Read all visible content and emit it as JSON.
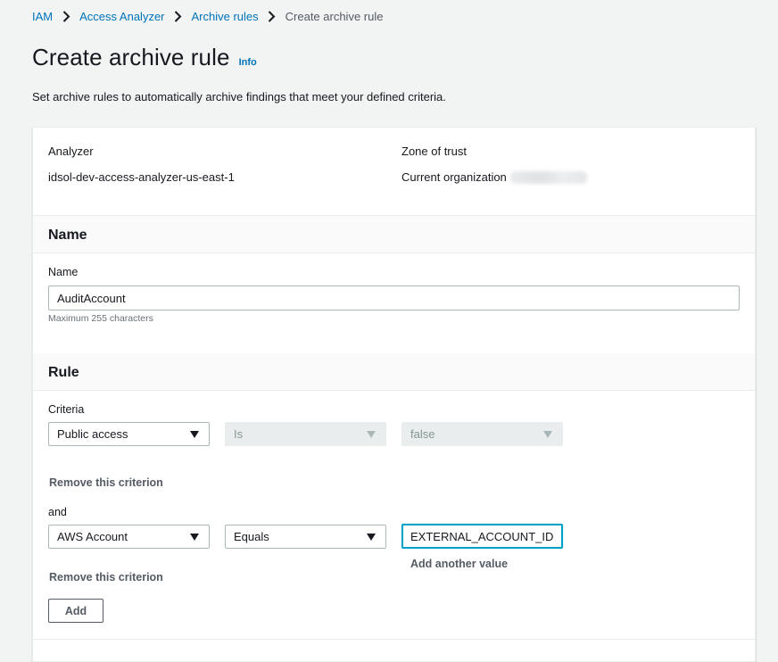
{
  "breadcrumb": [
    {
      "label": "IAM"
    },
    {
      "label": "Access Analyzer"
    },
    {
      "label": "Archive rules"
    },
    {
      "label": "Create archive rule"
    }
  ],
  "page": {
    "title": "Create archive rule",
    "info_link": "Info",
    "description": "Set archive rules to automatically archive findings that meet your defined criteria."
  },
  "summary": {
    "analyzer_label": "Analyzer",
    "analyzer_value": "idsol-dev-access-analyzer-us-east-1",
    "zone_label": "Zone of trust",
    "zone_value": "Current organization"
  },
  "name_section": {
    "header": "Name",
    "field_label": "Name",
    "value": "AuditAccount",
    "hint": "Maximum 255 characters"
  },
  "rule_section": {
    "header": "Rule",
    "criteria_label": "Criteria",
    "criterion1": {
      "property": "Public access",
      "operator": "Is",
      "value": "false",
      "remove": "Remove this criterion"
    },
    "and_label": "and",
    "criterion2": {
      "property": "AWS Account",
      "operator": "Equals",
      "value": "EXTERNAL_ACCOUNT_ID",
      "add_value": "Add another value",
      "remove": "Remove this criterion"
    },
    "add_button": "Add"
  },
  "colors": {
    "link": "#0073bb",
    "focus": "#00a1c9",
    "page_bg": "#f2f3f3"
  }
}
